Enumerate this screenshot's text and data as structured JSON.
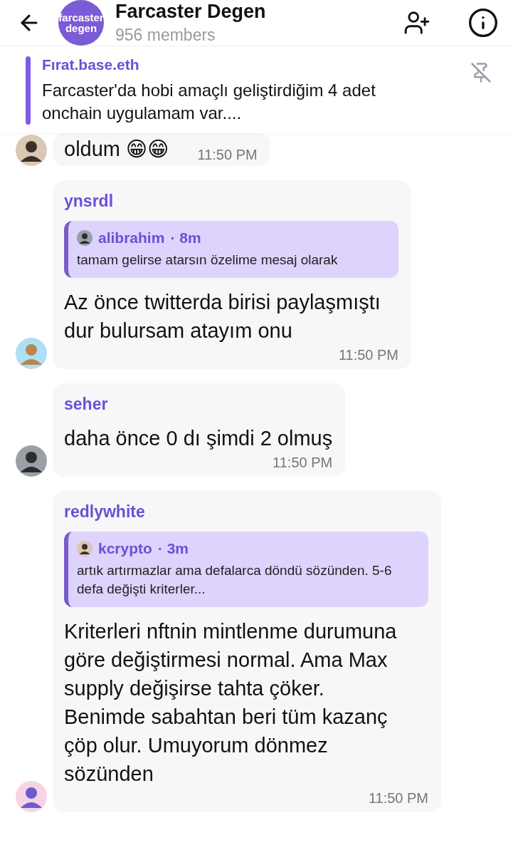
{
  "header": {
    "title": "Farcaster Degen",
    "logo_lines": [
      "farcaster",
      "degen"
    ],
    "subtitle": "956 members"
  },
  "pinned": {
    "author": "Fırat.base.eth",
    "text": "Farcaster'da hobi amaçlı geliştirdiğim 4 adet onchain uygulamam var...."
  },
  "messages": [
    {
      "text": "oldum 😁😁",
      "time": "11:50 PM"
    },
    {
      "author": "ynsrdl",
      "reply": {
        "author": "alibrahim",
        "age": "· 8m",
        "text": "tamam gelirse atarsın özelime mesaj olarak"
      },
      "text": "Az önce twitterda birisi paylaşmıştı dur bulursam atayım onu",
      "time": "11:50 PM"
    },
    {
      "author": "seher",
      "text": "daha önce 0 dı şimdi 2 olmuş",
      "time": "11:50 PM"
    },
    {
      "author": "redlywhite",
      "reply": {
        "author": "kcrypto",
        "age": "· 3m",
        "text": "artık artırmazlar ama defalarca döndü sözünden. 5-6 defa değişti kriterler..."
      },
      "text": "Kriterleri nftnin mintlenme durumuna göre değiştirmesi normal. Ama Max supply değişirse tahta çöker. Benimde sabahtan beri tüm kazanç çöp olur. Umuyorum dönmez sözünden",
      "time": "11:50 PM"
    }
  ]
}
